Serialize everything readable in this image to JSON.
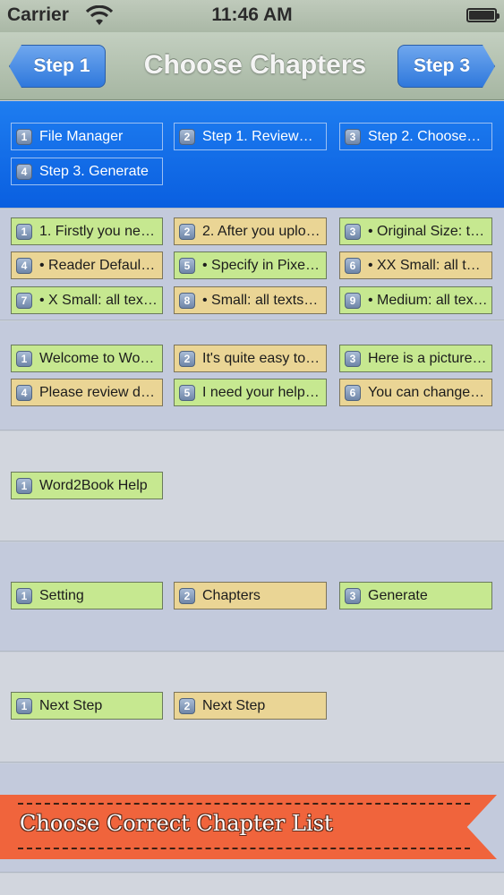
{
  "status_bar": {
    "carrier": "Carrier",
    "time": "11:46 AM"
  },
  "nav": {
    "back_label": "Step 1",
    "title": "Choose Chapters",
    "next_label": "Step 3"
  },
  "groups": [
    {
      "items": [
        {
          "num": "1",
          "label": "File Manager"
        },
        {
          "num": "2",
          "label": "Step 1. Review…"
        },
        {
          "num": "3",
          "label": "Step 2. Choose…"
        },
        {
          "num": "4",
          "label": "Step 3. Generate"
        }
      ]
    },
    {
      "items": [
        {
          "num": "1",
          "label": "1. Firstly you nee…",
          "color": "green"
        },
        {
          "num": "2",
          "label": "2. After you uplo…",
          "color": "tan"
        },
        {
          "num": "3",
          "label": "• Original Size: thi…",
          "color": "green"
        },
        {
          "num": "4",
          "label": "• Reader Default:…",
          "color": "tan"
        },
        {
          "num": "5",
          "label": "• Specify in Pixel…",
          "color": "green"
        },
        {
          "num": "6",
          "label": "• XX Small: all tex…",
          "color": "tan"
        },
        {
          "num": "7",
          "label": "• X Small: all text…",
          "color": "green"
        },
        {
          "num": "8",
          "label": "• Small: all texts…",
          "color": "tan"
        },
        {
          "num": "9",
          "label": "• Medium: all text…",
          "color": "green"
        }
      ]
    },
    {
      "items": [
        {
          "num": "1",
          "label": "Welcome to Wor…",
          "color": "green"
        },
        {
          "num": "2",
          "label": "It's quite easy to…",
          "color": "tan"
        },
        {
          "num": "3",
          "label": "Here is a picture…",
          "color": "green"
        },
        {
          "num": "4",
          "label": "Please review do…",
          "color": "tan"
        },
        {
          "num": "5",
          "label": "I need your help…",
          "color": "green"
        },
        {
          "num": "6",
          "label": "You can change…",
          "color": "tan"
        }
      ]
    },
    {
      "items": [
        {
          "num": "1",
          "label": "Word2Book Help",
          "color": "green"
        }
      ]
    },
    {
      "items": [
        {
          "num": "1",
          "label": "Setting",
          "color": "green"
        },
        {
          "num": "2",
          "label": "Chapters",
          "color": "tan"
        },
        {
          "num": "3",
          "label": "Generate",
          "color": "green"
        }
      ]
    },
    {
      "items": [
        {
          "num": "1",
          "label": "Next Step",
          "color": "green"
        },
        {
          "num": "2",
          "label": "Next Step",
          "color": "tan"
        }
      ]
    }
  ],
  "banner": {
    "text": "Choose Correct Chapter List"
  },
  "colors": {
    "chip_green": "#c6e890",
    "chip_tan": "#ead595",
    "selected_blue": "#0a5fe0",
    "banner": "#f0643c"
  }
}
